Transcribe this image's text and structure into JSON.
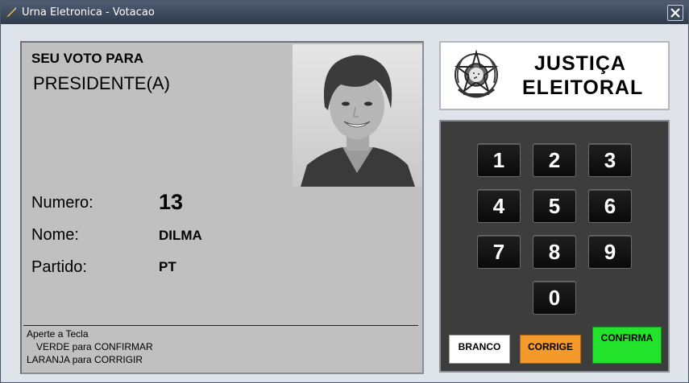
{
  "window": {
    "title": "Urna Eletronica - Votacao",
    "close_label": "✕"
  },
  "screen": {
    "heading": "SEU VOTO PARA",
    "office": "PRESIDENTE(A)",
    "fields": {
      "numero_label": "Numero:",
      "numero_value": "13",
      "nome_label": "Nome:",
      "nome_value": "DILMA",
      "partido_label": "Partido:",
      "partido_value": "PT"
    },
    "instructions": [
      "Aperte a Tecla",
      "VERDE para CONFIRMAR",
      "LARANJA para CORRIGIR"
    ]
  },
  "logo": {
    "line1": "JUSTIÇA",
    "line2": "ELEITORAL",
    "icon": "brazil-coat-of-arms"
  },
  "keypad": {
    "keys": [
      "1",
      "2",
      "3",
      "4",
      "5",
      "6",
      "7",
      "8",
      "9",
      "0"
    ],
    "branco": "BRANCO",
    "corrige": "CORRIGE",
    "confirma": "CONFIRMA"
  },
  "colors": {
    "branco": "#ffffff",
    "corrige": "#f39a2b",
    "confirma": "#22e22b",
    "keypad_bg": "#3d3d3d",
    "screen_bg": "#c0c0c0"
  }
}
